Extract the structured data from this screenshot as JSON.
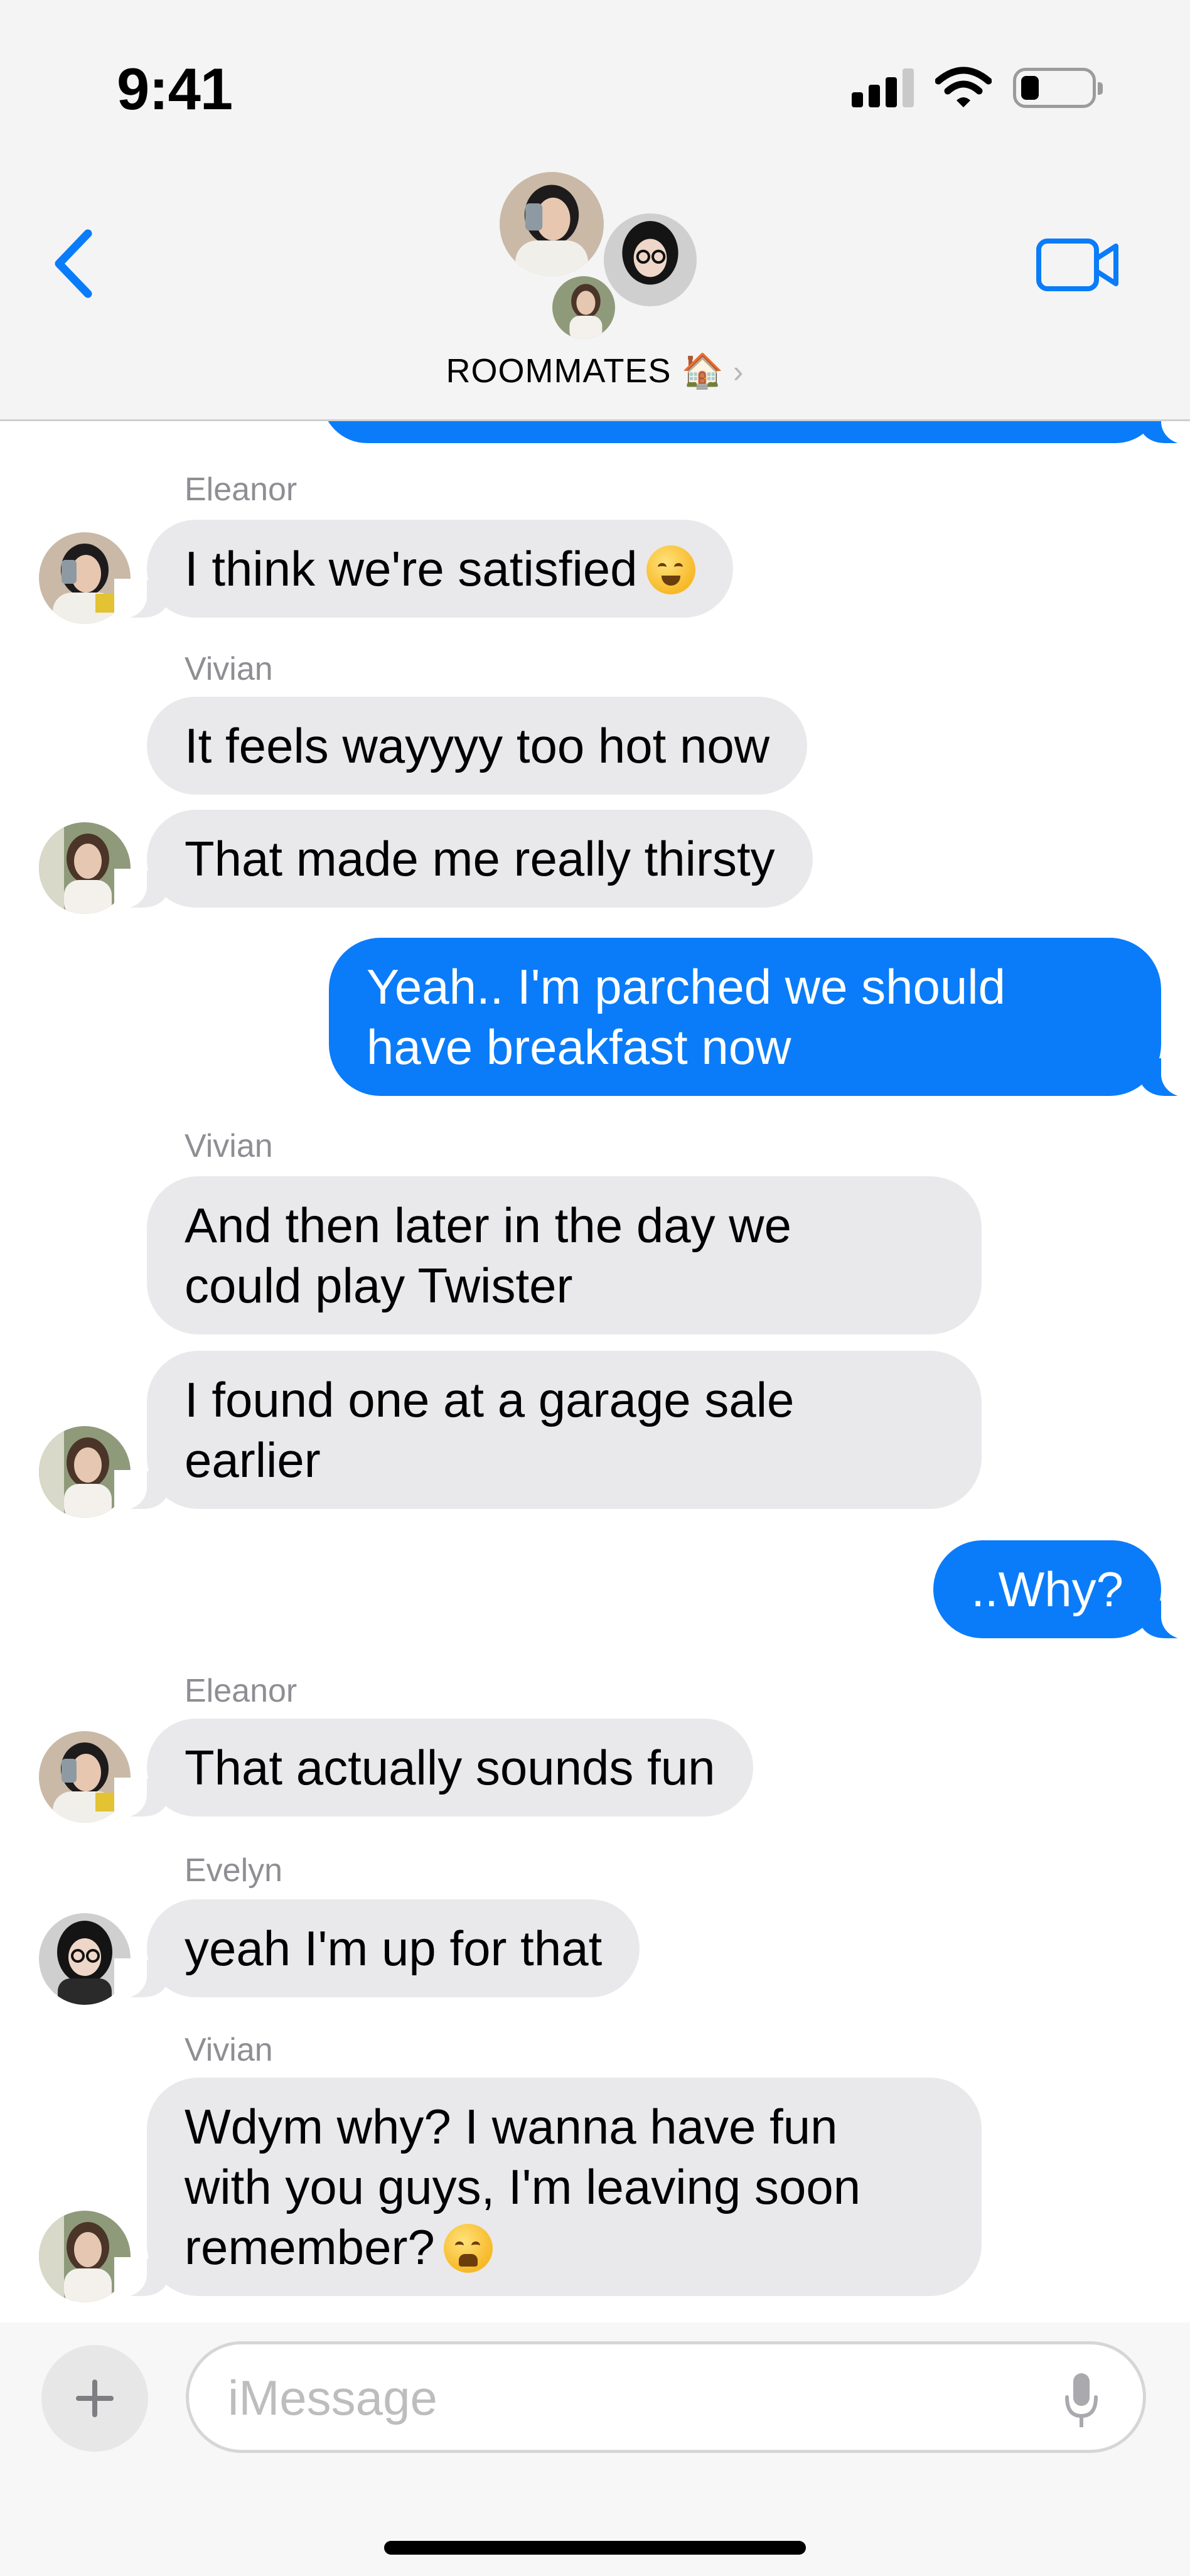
{
  "status_bar": {
    "time": "9:41"
  },
  "header": {
    "group_name": "ROOMMATES",
    "group_emoji": "🏠",
    "chevron": "›"
  },
  "messages": {
    "m1_sender": "Eleanor",
    "m1_text": "I think we're satisfied",
    "m2_sender": "Vivian",
    "m2_text": "It feels wayyyy too hot now",
    "m3_text": "That made me really thirsty",
    "m4_line1": "Yeah.. I'm parched we should",
    "m4_line2": "have breakfast now",
    "m5_sender": "Vivian",
    "m5_line1": "And then later in the day we",
    "m5_line2": "could play Twister",
    "m6_line1": "I found one at a garage sale",
    "m6_line2": "earlier",
    "m7_text": "..Why?",
    "m8_sender": "Eleanor",
    "m8_text": "That actually sounds fun",
    "m9_sender": "Evelyn",
    "m9_text": "yeah I'm up for that",
    "m10_sender": "Vivian",
    "m10_line1": "Wdym why? I wanna have fun",
    "m10_line2": "with you guys, I'm leaving soon",
    "m10_line3": "remember?"
  },
  "input": {
    "placeholder": "iMessage"
  },
  "colors": {
    "accent": "#0a7cf9",
    "incoming_bubble": "#e9e9eb",
    "header_bg": "#f4f4f4"
  },
  "icons": [
    "back-chevron-icon",
    "video-call-icon",
    "plus-icon",
    "microphone-icon",
    "wifi-icon",
    "battery-icon",
    "signal-icon"
  ]
}
